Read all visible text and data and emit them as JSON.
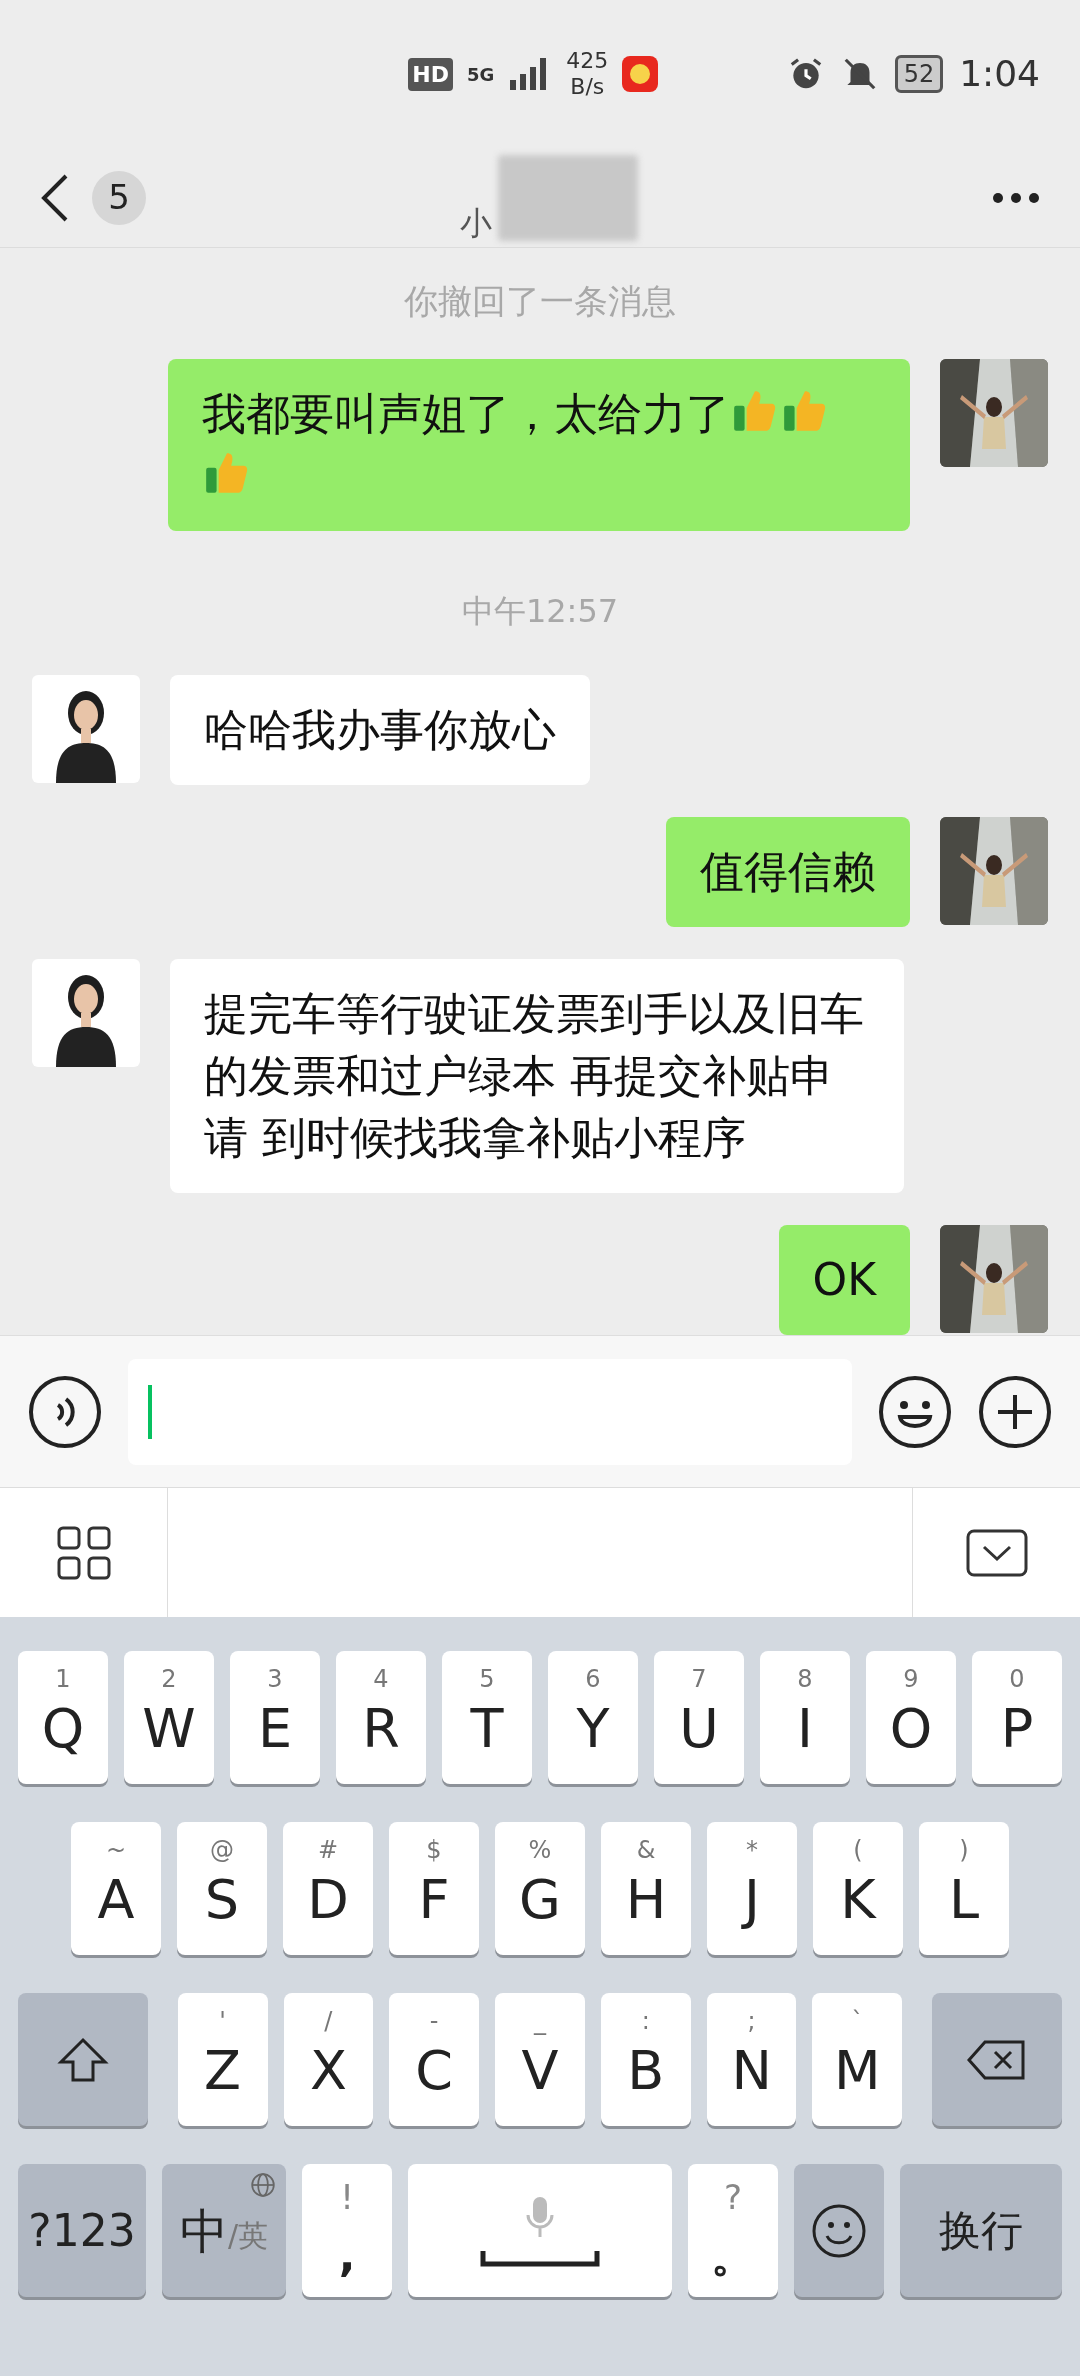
{
  "status_bar": {
    "hd": "HD",
    "network": "5G",
    "speed_value": "425",
    "speed_unit": "B/s",
    "battery": "52",
    "time": "1:04"
  },
  "header": {
    "unread": "5",
    "title": "小"
  },
  "messages": [
    {
      "kind": "notice",
      "text": "你撤回了一条消息"
    },
    {
      "kind": "outgoing",
      "text": "我都要叫声姐了，太给力了",
      "emoji": [
        {
          "kind": "thumbs-up"
        },
        {
          "kind": "thumbs-up"
        },
        {
          "kind": "thumbs-up"
        }
      ]
    },
    {
      "kind": "time",
      "text": "中午12:57"
    },
    {
      "kind": "incoming",
      "text": "哈哈我办事你放心"
    },
    {
      "kind": "outgoing",
      "text": "值得信赖"
    },
    {
      "kind": "incoming",
      "text": "提完车等行驶证发票到手以及旧车的发票和过户绿本 再提交补贴申请 到时候找我拿补贴小程序"
    },
    {
      "kind": "outgoing",
      "text": "OK"
    }
  ],
  "keyboard": {
    "rows": [
      [
        {
          "hint": "1",
          "key": "Q"
        },
        {
          "hint": "2",
          "key": "W"
        },
        {
          "hint": "3",
          "key": "E"
        },
        {
          "hint": "4",
          "key": "R"
        },
        {
          "hint": "5",
          "key": "T"
        },
        {
          "hint": "6",
          "key": "Y"
        },
        {
          "hint": "7",
          "key": "U"
        },
        {
          "hint": "8",
          "key": "I"
        },
        {
          "hint": "9",
          "key": "O"
        },
        {
          "hint": "0",
          "key": "P"
        }
      ],
      [
        {
          "hint": "~",
          "key": "A"
        },
        {
          "hint": "@",
          "key": "S"
        },
        {
          "hint": "#",
          "key": "D"
        },
        {
          "hint": "$",
          "key": "F"
        },
        {
          "hint": "%",
          "key": "G"
        },
        {
          "hint": "&",
          "key": "H"
        },
        {
          "hint": "*",
          "key": "J"
        },
        {
          "hint": "(",
          "key": "K"
        },
        {
          "hint": ")",
          "key": "L"
        }
      ],
      [
        {
          "hint": "'",
          "key": "Z"
        },
        {
          "hint": "/",
          "key": "X"
        },
        {
          "hint": "-",
          "key": "C"
        },
        {
          "hint": "_",
          "key": "V"
        },
        {
          "hint": ":",
          "key": "B"
        },
        {
          "hint": ";",
          "key": "N"
        },
        {
          "hint": "`",
          "key": "M"
        }
      ]
    ],
    "bottom": [
      {
        "kind": "symbols",
        "key": "?123"
      },
      {
        "kind": "lang",
        "key": "中",
        "hint": "/英"
      },
      {
        "kind": "punct",
        "hint": "!",
        "key": ","
      },
      {
        "kind": "space"
      },
      {
        "kind": "punct",
        "hint": "?",
        "key": "。"
      },
      {
        "kind": "emoji"
      },
      {
        "kind": "enter",
        "key": "换行"
      }
    ]
  }
}
